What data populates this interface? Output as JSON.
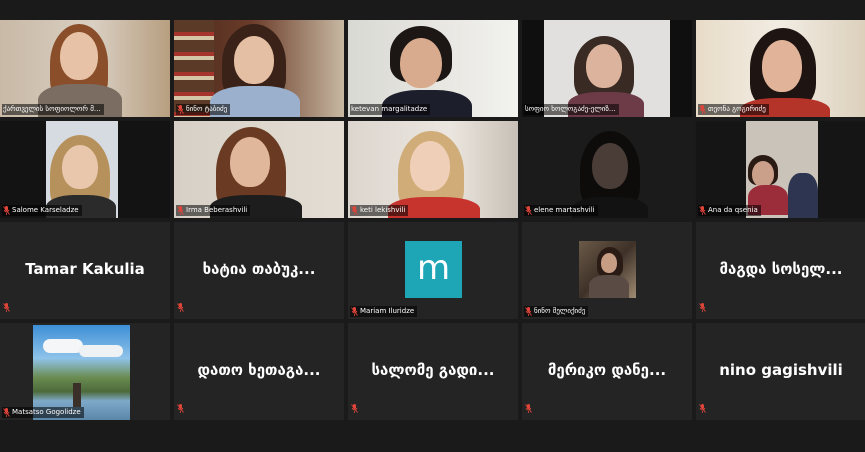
{
  "participants": [
    {
      "name": "ქართველის სოფიოლორ მ...",
      "kind": "video",
      "active": true,
      "muted": false
    },
    {
      "name": "ნინო ტაბიძე",
      "kind": "video",
      "muted": true
    },
    {
      "name": "ketevan margalitadze",
      "kind": "video",
      "muted": false
    },
    {
      "name": "სოფიო ხოლოგაძე-ელიზ...",
      "kind": "video",
      "muted": false
    },
    {
      "name": "თეონა გოგირიძე",
      "kind": "video",
      "muted": true
    },
    {
      "name": "Salome Karseladze",
      "kind": "video",
      "muted": true
    },
    {
      "name": "Irma Beberashvili",
      "kind": "video",
      "muted": true
    },
    {
      "name": "keti lekishvili",
      "kind": "video",
      "muted": true
    },
    {
      "name": "elene martashvili",
      "kind": "video",
      "muted": true
    },
    {
      "name": "Ana da qsenia",
      "kind": "video",
      "muted": true
    },
    {
      "name": "Tamar Kakulia",
      "kind": "text",
      "muted": true
    },
    {
      "name": "ხატია თაბუკ...",
      "kind": "text",
      "muted": true
    },
    {
      "name": "Mariam Iluridze",
      "kind": "logo",
      "logo_letter": "m",
      "muted": true
    },
    {
      "name": "ნინო მელიქიძე",
      "kind": "avatar",
      "muted": true
    },
    {
      "name": "მაგდა სოსელ...",
      "kind": "text",
      "muted": true
    },
    {
      "name": "Matsatso Gogolidze",
      "kind": "avatar",
      "muted": true
    },
    {
      "name": "დათო ხეთაგა...",
      "kind": "text",
      "muted": true
    },
    {
      "name": "სალომე გადი...",
      "kind": "text",
      "muted": true
    },
    {
      "name": "მერიკო დანე...",
      "kind": "text",
      "muted": true
    },
    {
      "name": "nino gagishvili",
      "kind": "text",
      "muted": true
    }
  ],
  "colors": {
    "active_border": "#d8d04a",
    "muted_mic": "#e0453a",
    "logo_bg": "#1ea5b6"
  }
}
